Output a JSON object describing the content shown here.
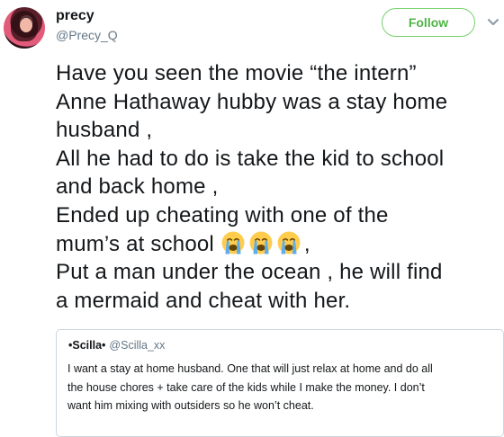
{
  "tweet": {
    "author": {
      "display_name": "precy",
      "handle": "@Precy_Q",
      "avatar_icon": "profile-photo"
    },
    "follow_label": "Follow",
    "follow_color": "#4fb446",
    "text_lines": [
      "Have you seen the movie “the intern”",
      "Anne Hathaway hubby was a stay home",
      "husband ,",
      "All he had to do is take the kid to school",
      "and back home ,",
      "Ended up cheating with one of the",
      "mum’s at school",
      "Put a man under the ocean , he will find",
      "a mermaid and cheat with her."
    ],
    "line7_suffix": ",",
    "emojis": [
      "loudly-crying-face-icon",
      "loudly-crying-face-icon",
      "loudly-crying-face-icon"
    ],
    "quoted_tweet": {
      "display_name": "•Scilla•",
      "handle": "@Scilla_xx",
      "text_lines": [
        "I want a stay at home husband. One that will just relax at home and do all",
        "the house chores + take care of the kids while I make the money. I don’t",
        "want him mixing with outsiders so he won’t cheat."
      ]
    }
  }
}
